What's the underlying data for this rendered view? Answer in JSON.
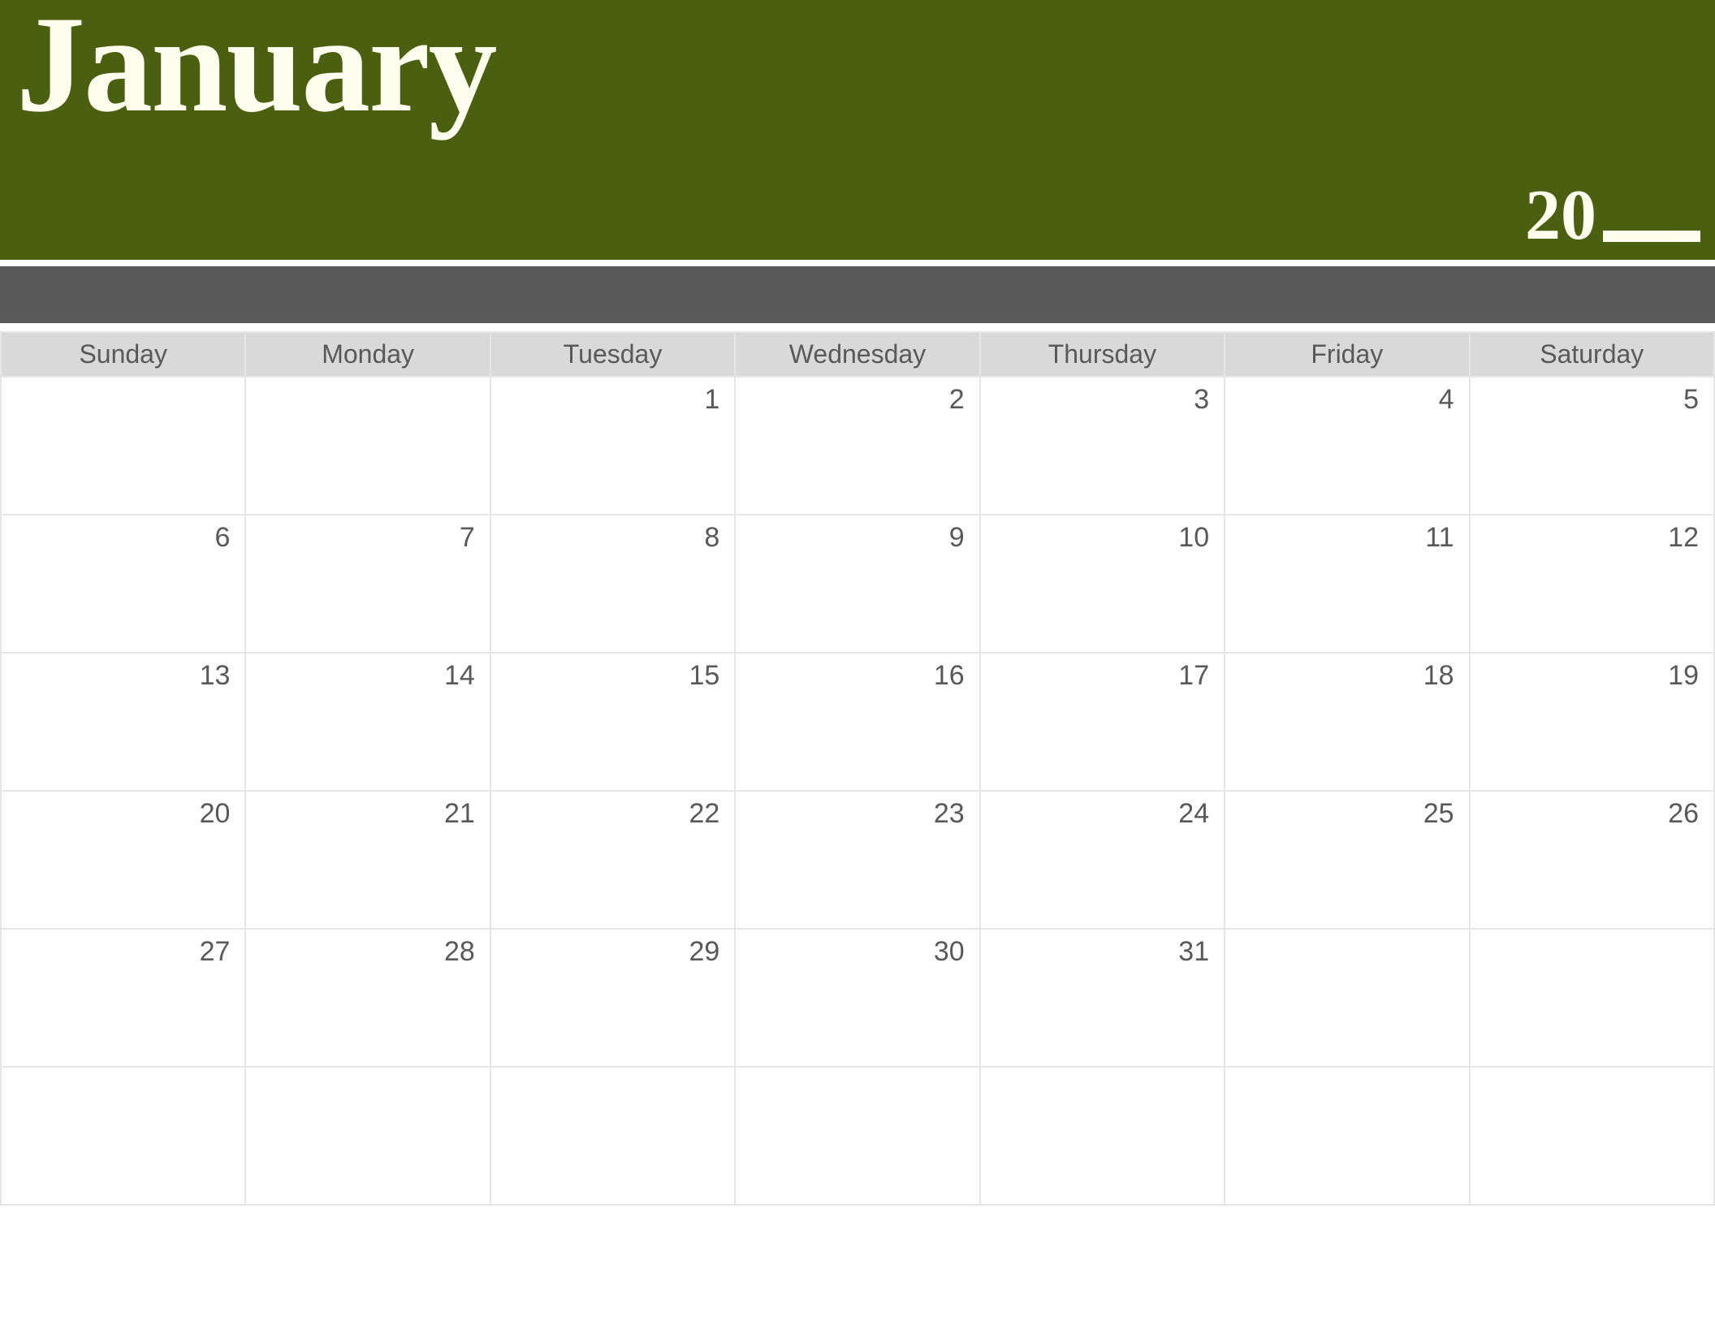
{
  "header": {
    "month": "January",
    "year_prefix": "20"
  },
  "colors": {
    "header_bg": "#4a5f0f",
    "subbar_bg": "#595959",
    "dayhead_bg": "#d9d9d9",
    "text_muted": "#595959",
    "header_fg": "#fdfeee"
  },
  "days_of_week": [
    "Sunday",
    "Monday",
    "Tuesday",
    "Wednesday",
    "Thursday",
    "Friday",
    "Saturday"
  ],
  "weeks": [
    [
      "",
      "",
      "1",
      "2",
      "3",
      "4",
      "5"
    ],
    [
      "6",
      "7",
      "8",
      "9",
      "10",
      "11",
      "12"
    ],
    [
      "13",
      "14",
      "15",
      "16",
      "17",
      "18",
      "19"
    ],
    [
      "20",
      "21",
      "22",
      "23",
      "24",
      "25",
      "26"
    ],
    [
      "27",
      "28",
      "29",
      "30",
      "31",
      "",
      ""
    ],
    [
      "",
      "",
      "",
      "",
      "",
      "",
      ""
    ]
  ]
}
